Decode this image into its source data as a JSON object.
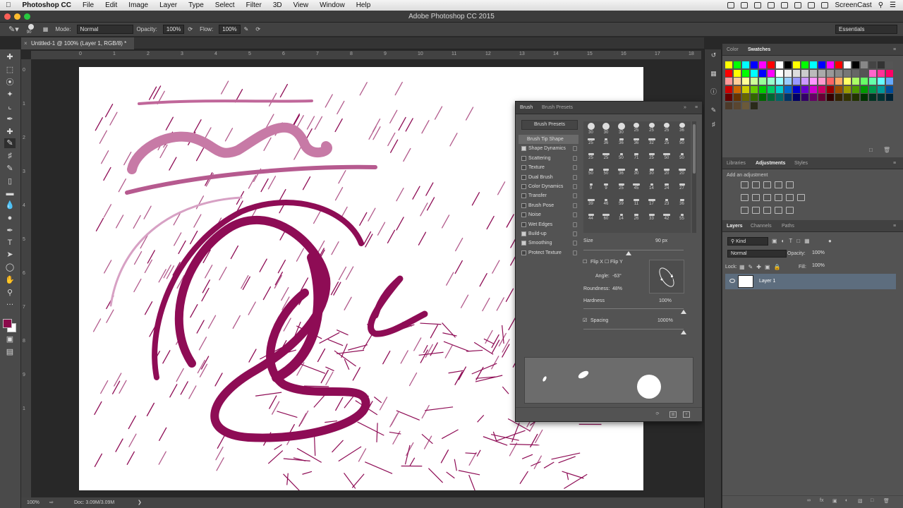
{
  "menubar": {
    "app": "Photoshop CC",
    "items": [
      "File",
      "Edit",
      "Image",
      "Layer",
      "Type",
      "Select",
      "Filter",
      "3D",
      "View",
      "Window",
      "Help"
    ],
    "screencast": "ScreenCast"
  },
  "window": {
    "title": "Adobe Photoshop CC 2015"
  },
  "options": {
    "brush_size": "90",
    "mode_label": "Mode:",
    "mode_value": "Normal",
    "opacity_label": "Opacity:",
    "opacity_value": "100%",
    "flow_label": "Flow:",
    "flow_value": "100%",
    "workspace": "Essentials"
  },
  "document": {
    "tab_title": "Untitled-1 @ 100% (Layer 1, RGB/8) *"
  },
  "rulers": {
    "top": [
      "0",
      "1",
      "2",
      "3",
      "4",
      "5",
      "6",
      "7",
      "8",
      "9",
      "10",
      "11",
      "12",
      "13",
      "14",
      "15",
      "16",
      "17",
      "18"
    ],
    "left": [
      "0",
      "1",
      "2",
      "3",
      "4",
      "5",
      "6",
      "7",
      "8",
      "9",
      "1"
    ]
  },
  "status": {
    "zoom": "100%",
    "doc": "Doc: 3.09M/3.09M"
  },
  "brush_panel": {
    "tab_brush": "Brush",
    "tab_presets": "Brush Presets",
    "presets_button": "Brush Presets",
    "tip_shape": "Brush Tip Shape",
    "options": [
      {
        "label": "Shape Dynamics",
        "checked": true
      },
      {
        "label": "Scattering",
        "checked": false
      },
      {
        "label": "Texture",
        "checked": false
      },
      {
        "label": "Dual Brush",
        "checked": false
      },
      {
        "label": "Color Dynamics",
        "checked": false
      },
      {
        "label": "Transfer",
        "checked": false
      },
      {
        "label": "Brush Pose",
        "checked": false
      },
      {
        "label": "Noise",
        "checked": false
      },
      {
        "label": "Wet Edges",
        "checked": false
      },
      {
        "label": "Build-up",
        "checked": true
      },
      {
        "label": "Smoothing",
        "checked": true
      },
      {
        "label": "Protect Texture",
        "checked": false
      }
    ],
    "tip_sizes": [
      "30",
      "30",
      "30",
      "25",
      "25",
      "25",
      "36",
      "25",
      "36",
      "36",
      "36",
      "32",
      "25",
      "50",
      "25",
      "25",
      "50",
      "71",
      "25",
      "50",
      "50",
      "50",
      "50",
      "36",
      "30",
      "30",
      "20",
      "20",
      "9",
      "9",
      "25",
      "45",
      "14",
      "24",
      "27",
      "39",
      "46",
      "59",
      "11",
      "17",
      "23",
      "36",
      "44",
      "60",
      "14",
      "26",
      "33",
      "42",
      "55"
    ],
    "size_label": "Size",
    "size_value": "90 px",
    "size_fraction": 0.45,
    "flip_x": "Flip X",
    "flip_y": "Flip Y",
    "angle_label": "Angle:",
    "angle_value": "-63°",
    "roundness_label": "Roundness:",
    "roundness_value": "48%",
    "hardness_label": "Hardness",
    "hardness_value": "100%",
    "spacing_label": "Spacing",
    "spacing_value": "1000%"
  },
  "color_panel": {
    "tab_color": "Color",
    "tab_swatches": "Swatches",
    "swatch_rows": [
      [
        "#ffff00",
        "#00ff00",
        "#00ffff",
        "#0000ff",
        "#ff00ff",
        "#ff0000",
        "#ffffff",
        "#000000",
        "#ffff00",
        "#00ff00",
        "#00ffff",
        "#0000ff",
        "#ff00ff",
        "#ff0000",
        "#ffffff",
        "#000000",
        "#888888",
        "#444444",
        "#333333",
        "#555555"
      ],
      [
        "#ff0000",
        "#ffff00",
        "#00ff00",
        "#00ffff",
        "#0000ff",
        "#ff00ff",
        "#ffffff",
        "#eeeeee",
        "#dddddd",
        "#cccccc",
        "#bbbbbb",
        "#aaaaaa",
        "#999999",
        "#888888",
        "#777777",
        "#666666",
        "#555555",
        "#ff66cc",
        "#ff3399",
        "#ff0066"
      ],
      [
        "#ff9999",
        "#ffcc99",
        "#ffff99",
        "#ccff99",
        "#99ff99",
        "#99ffcc",
        "#99ffff",
        "#99ccff",
        "#9999ff",
        "#cc99ff",
        "#ff99ff",
        "#ff99cc",
        "#ff6666",
        "#ffaa66",
        "#ffff66",
        "#aaff66",
        "#66ff66",
        "#66ffaa",
        "#66ffff",
        "#66aaff"
      ],
      [
        "#cc0000",
        "#cc6600",
        "#cccc00",
        "#66cc00",
        "#00cc00",
        "#00cc66",
        "#00cccc",
        "#0066cc",
        "#0000cc",
        "#6600cc",
        "#cc00cc",
        "#cc0066",
        "#990000",
        "#994c00",
        "#999900",
        "#4c9900",
        "#009900",
        "#00994c",
        "#009999",
        "#004c99"
      ],
      [
        "#660000",
        "#663300",
        "#666600",
        "#336600",
        "#006600",
        "#006633",
        "#006666",
        "#003366",
        "#000066",
        "#330066",
        "#660066",
        "#660033",
        "#330000",
        "#332200",
        "#333300",
        "#223300",
        "#003300",
        "#003322",
        "#003333",
        "#002233"
      ],
      [
        "#4c3a2a",
        "#5a4630",
        "#6b5a3a",
        "#2a2a1a"
      ]
    ]
  },
  "adjustments_panel": {
    "tab_libraries": "Libraries",
    "tab_adjustments": "Adjustments",
    "tab_styles": "Styles",
    "title": "Add an adjustment"
  },
  "layers_panel": {
    "tab_layers": "Layers",
    "tab_channels": "Channels",
    "tab_paths": "Paths",
    "filter": "Kind",
    "blend_mode": "Normal",
    "opacity_label": "Opacity:",
    "opacity_value": "100%",
    "lock_label": "Lock:",
    "fill_label": "Fill:",
    "fill_value": "100%",
    "layer_name": "Layer 1"
  },
  "colors": {
    "foreground": "#8a0a4b",
    "background": "#ffffff",
    "paint": "#8e0c55",
    "accent_layer": "#5d6d7e"
  }
}
